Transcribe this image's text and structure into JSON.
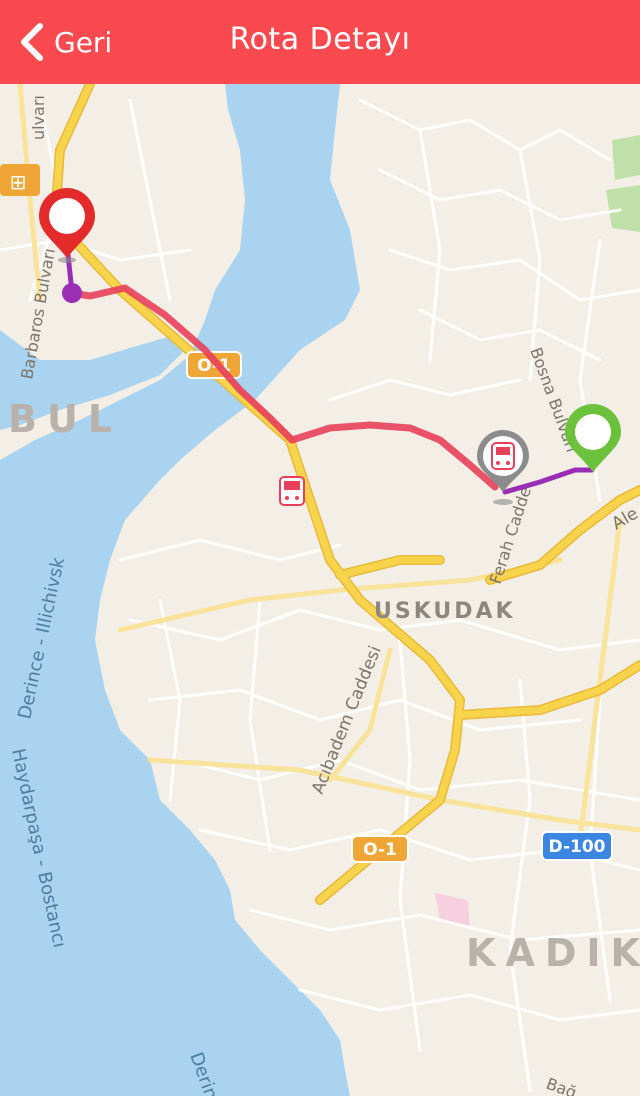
{
  "navbar": {
    "back_label": "Geri",
    "title": "Rota Detayı",
    "background_color": "#fa4a4f"
  },
  "map": {
    "district_labels": [
      "BUL",
      "USKUDAK",
      "KADIK"
    ],
    "street_labels": [
      "Barbaros Bulvarı",
      "Bosna Bulvarı",
      "Ferah Cadde",
      "Acıbadem Caddesi",
      "Ale",
      "Bağ",
      "ulvarı"
    ],
    "water_labels": [
      "Derince - Illichivsk",
      "Haydarpaşa - Bostancı",
      "Derin"
    ],
    "road_shields": [
      {
        "text": "O-1",
        "style": "orange"
      },
      {
        "text": "O-1",
        "style": "orange"
      },
      {
        "text": "D-100",
        "style": "blue"
      }
    ],
    "route": {
      "main_color": "#e8405a",
      "walk_color": "#9a2fb5"
    },
    "markers": {
      "start_pin_color": "#e32b2b",
      "end_pin_color": "#6cc23c",
      "bus_stop_icon": "bus-icon",
      "bus_station_icon": "bus-icon"
    },
    "colors": {
      "water": "#a9d3ee",
      "land": "#f4efe6",
      "highway": "#f7d44c",
      "park": "#bfe0a8"
    }
  }
}
